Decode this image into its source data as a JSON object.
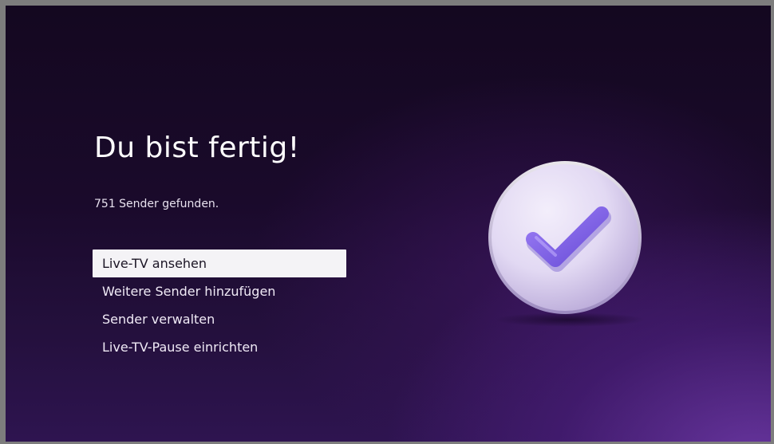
{
  "screen": {
    "title": "Du bist fertig!",
    "status": "751 Sender gefunden."
  },
  "menu": {
    "items": [
      {
        "label": "Live-TV ansehen",
        "selected": true
      },
      {
        "label": "Weitere Sender hinzufügen",
        "selected": false
      },
      {
        "label": "Sender verwalten",
        "selected": false
      },
      {
        "label": "Live-TV-Pause einrichten",
        "selected": false
      }
    ]
  },
  "illustration": {
    "icon": "checkmark-icon",
    "badge_color": "#e6def5",
    "check_color": "#7b5ce6"
  },
  "colors": {
    "background_dark": "#140820",
    "background_glow": "#703aaa",
    "frame": "#7d7d7d",
    "selected_bg": "#f4f3f6"
  }
}
